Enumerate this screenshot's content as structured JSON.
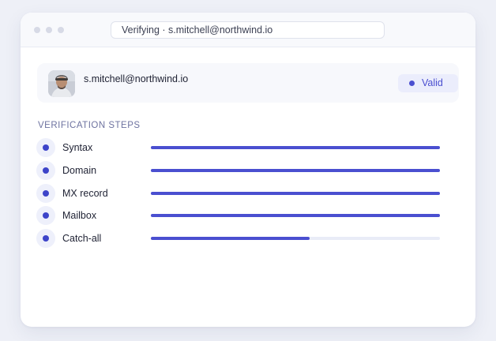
{
  "browser": {
    "url_text": "Verifying · s.mitchell@northwind.io"
  },
  "user": {
    "email": "s.mitchell@northwind.io",
    "status": "Valid"
  },
  "colors": {
    "accent": "#4a4fd0",
    "track": "#e9ecf7"
  },
  "section": {
    "title": "VERIFICATION STEPS"
  },
  "steps": [
    {
      "label": "Syntax",
      "progress": 1.0
    },
    {
      "label": "Domain",
      "progress": 1.0
    },
    {
      "label": "MX record",
      "progress": 1.0
    },
    {
      "label": "Mailbox",
      "progress": 1.0
    },
    {
      "label": "Catch-all",
      "progress": 0.55
    }
  ]
}
